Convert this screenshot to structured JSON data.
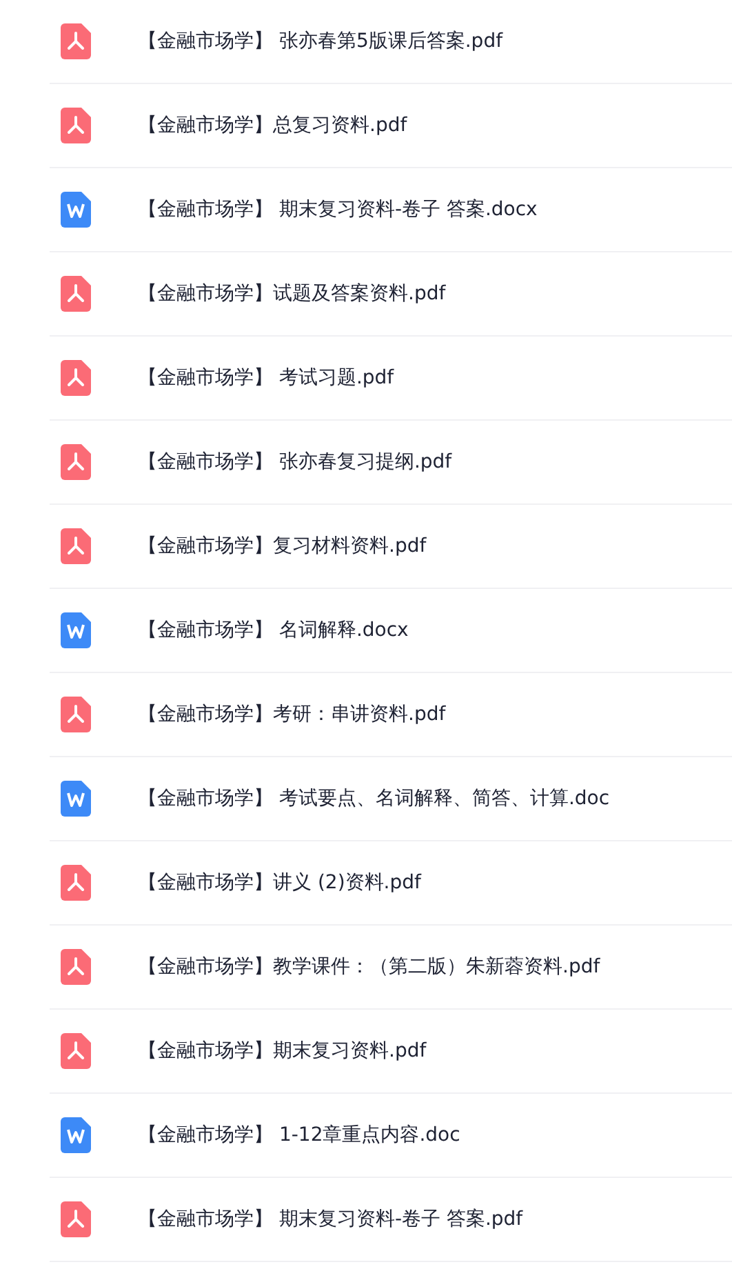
{
  "files": [
    {
      "kind": "pdf",
      "name": "【金融市场学】 张亦春第5版课后答案.pdf"
    },
    {
      "kind": "pdf",
      "name": "【金融市场学】总复习资料.pdf"
    },
    {
      "kind": "word",
      "name": "【金融市场学】 期末复习资料-卷子 答案.docx"
    },
    {
      "kind": "pdf",
      "name": "【金融市场学】试题及答案资料.pdf"
    },
    {
      "kind": "pdf",
      "name": "【金融市场学】 考试习题.pdf"
    },
    {
      "kind": "pdf",
      "name": "【金融市场学】 张亦春复习提纲.pdf"
    },
    {
      "kind": "pdf",
      "name": "【金融市场学】复习材料资料.pdf"
    },
    {
      "kind": "word",
      "name": "【金融市场学】 名词解释.docx"
    },
    {
      "kind": "pdf",
      "name": "【金融市场学】考研：串讲资料.pdf"
    },
    {
      "kind": "word",
      "name": "【金融市场学】 考试要点、名词解释、简答、计算.doc"
    },
    {
      "kind": "pdf",
      "name": "【金融市场学】讲义 (2)资料.pdf"
    },
    {
      "kind": "pdf",
      "name": "【金融市场学】教学课件：（第二版）朱新蓉资料.pdf"
    },
    {
      "kind": "pdf",
      "name": "【金融市场学】期末复习资料.pdf"
    },
    {
      "kind": "word",
      "name": "【金融市场学】 1-12章重点内容.doc"
    },
    {
      "kind": "pdf",
      "name": "【金融市场学】 期末复习资料-卷子 答案.pdf"
    }
  ]
}
